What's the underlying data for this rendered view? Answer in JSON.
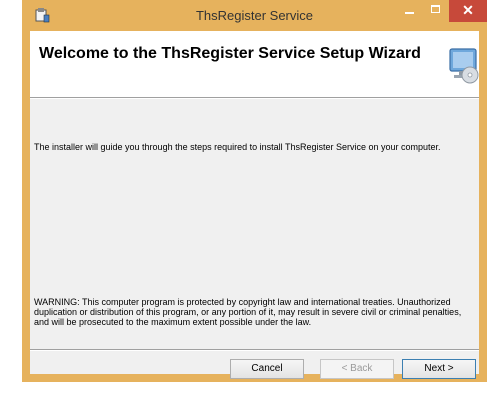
{
  "window": {
    "title": "ThsRegister Service",
    "controls": {
      "minimize": "minimize",
      "maximize": "maximize",
      "close": "✕"
    }
  },
  "banner": {
    "heading": "Welcome to the ThsRegister Service Setup Wizard",
    "icon": "computer-cd-icon"
  },
  "body": {
    "intro": "The installer will guide you through the steps required to install ThsRegister Service on your computer.",
    "warning": "WARNING: This computer program is protected by copyright law and international treaties. Unauthorized duplication or distribution of this program, or any portion of it, may result in severe civil or criminal penalties, and will be prosecuted to the maximum extent possible under the law."
  },
  "buttons": {
    "cancel": "Cancel",
    "back": "< Back",
    "next": "Next >"
  },
  "colors": {
    "titlebar": "#e6b25d",
    "close": "#c7493a"
  }
}
